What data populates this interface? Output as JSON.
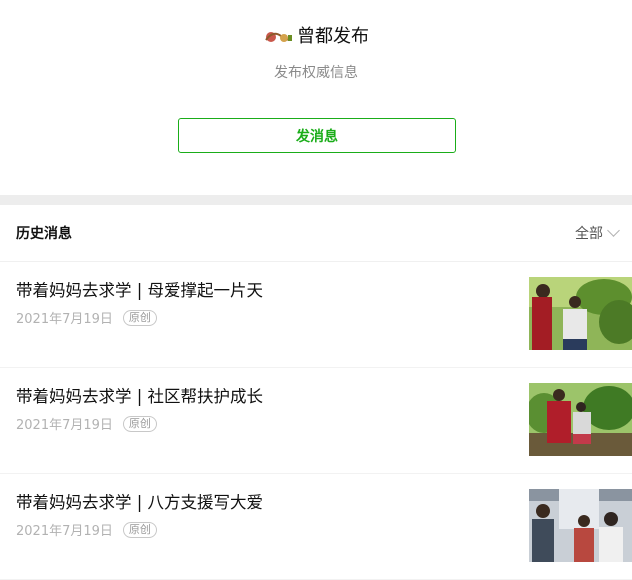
{
  "account": {
    "name": "曾都发布",
    "description": "发布权威信息",
    "logo_icon": "account-logo-icon",
    "send_button": "发消息",
    "accent": "#1aad19"
  },
  "history": {
    "title": "历史消息",
    "filter_label": "全部"
  },
  "articles": [
    {
      "title": "带着妈妈去求学 | 母爱撑起一片天",
      "date": "2021年7月19日",
      "badge": "原创"
    },
    {
      "title": "带着妈妈去求学 | 社区帮扶护成长",
      "date": "2021年7月19日",
      "badge": "原创"
    },
    {
      "title": "带着妈妈去求学 | 八方支援写大爱",
      "date": "2021年7月19日",
      "badge": "原创"
    }
  ]
}
